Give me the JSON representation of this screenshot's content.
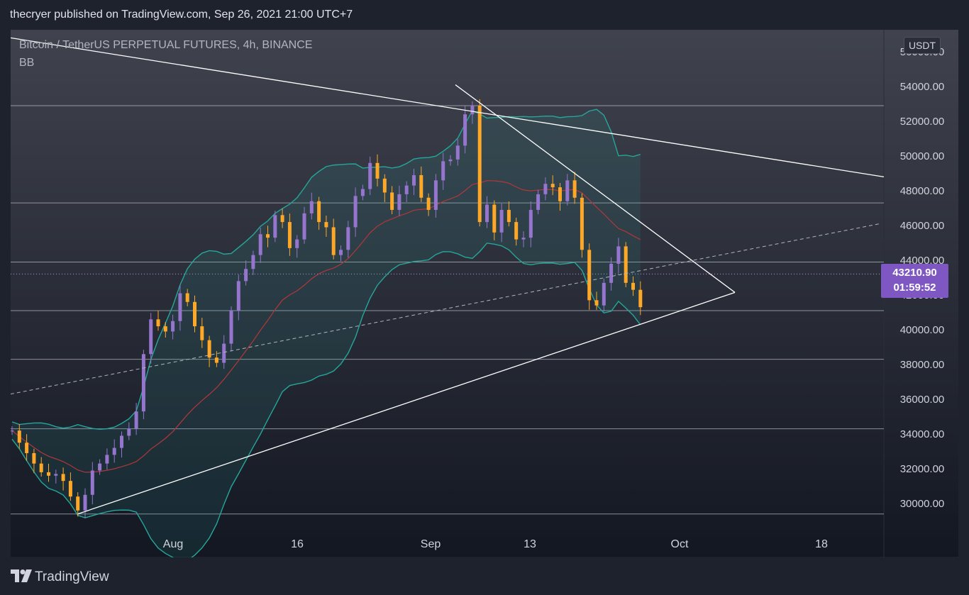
{
  "header": {
    "publisher": "thecryer published on TradingView.com, Sep 26, 2021 21:00 UTC+7"
  },
  "legend": {
    "symbol": "Bitcoin / TetherUS PERPETUAL FUTURES, 4h, BINANCE",
    "indicator": "BB"
  },
  "price_axis": {
    "currency": "USDT",
    "current_price": "43210.90",
    "countdown": "01:59:52"
  },
  "footer": {
    "brand": "TradingView"
  },
  "colors": {
    "background": "#1e222d",
    "up_candle": "#9575cd",
    "down_candle": "#ffa726",
    "bands": "#26a69a",
    "basis": "#b2373a",
    "price_tag": "#7e57c2",
    "trendlines": "#ffffff"
  },
  "chart_data": {
    "type": "line",
    "title": "Bitcoin / TetherUS PERPETUAL FUTURES, 4h, BINANCE",
    "xlabel": "",
    "ylabel": "",
    "x_ticks": [
      "Aug",
      "16",
      "Sep",
      "13",
      "Oct",
      "18"
    ],
    "y_ticks": [
      "30000.00",
      "32000.00",
      "34000.00",
      "36000.00",
      "38000.00",
      "40000.00",
      "42000.00",
      "44000.00",
      "46000.00",
      "48000.00",
      "50000.00",
      "52000.00",
      "54000.00",
      "56000.00"
    ],
    "ylim": [
      28500,
      56800
    ],
    "horizontal_levels": [
      29400,
      34300,
      38300,
      41100,
      43900,
      47300,
      52900
    ],
    "series": [
      {
        "values": [
          34200,
          33500,
          32900,
          32300,
          31800,
          31600,
          31700,
          31300,
          30400,
          29600,
          30500,
          31900,
          32300,
          32800,
          33200,
          33900,
          34300,
          35300,
          38600,
          40600,
          40200,
          39900,
          40500,
          42100,
          41600,
          40200,
          39400,
          38400,
          38100,
          39200,
          41100,
          42800,
          43500,
          44300,
          45500,
          45300,
          46600,
          46200,
          44700,
          45200,
          46700,
          47400,
          46200,
          45900,
          44300,
          44600,
          45900,
          47700,
          48100,
          49600,
          48700,
          47900,
          46900,
          47800,
          48300,
          48900,
          47600,
          46900,
          48600,
          49700,
          49800,
          50600,
          52400,
          52900,
          46200,
          47200,
          45600,
          46900,
          46200,
          45200,
          45300,
          46900,
          47800,
          48400,
          48200,
          47400,
          48600,
          47600,
          44600,
          41700,
          41400,
          42700,
          43800,
          44800,
          42700,
          42300,
          41300
        ]
      }
    ],
    "indicator": "BB",
    "annotations": [
      "falling resistance trendline",
      "rising support trendline",
      "dashed support line"
    ]
  }
}
